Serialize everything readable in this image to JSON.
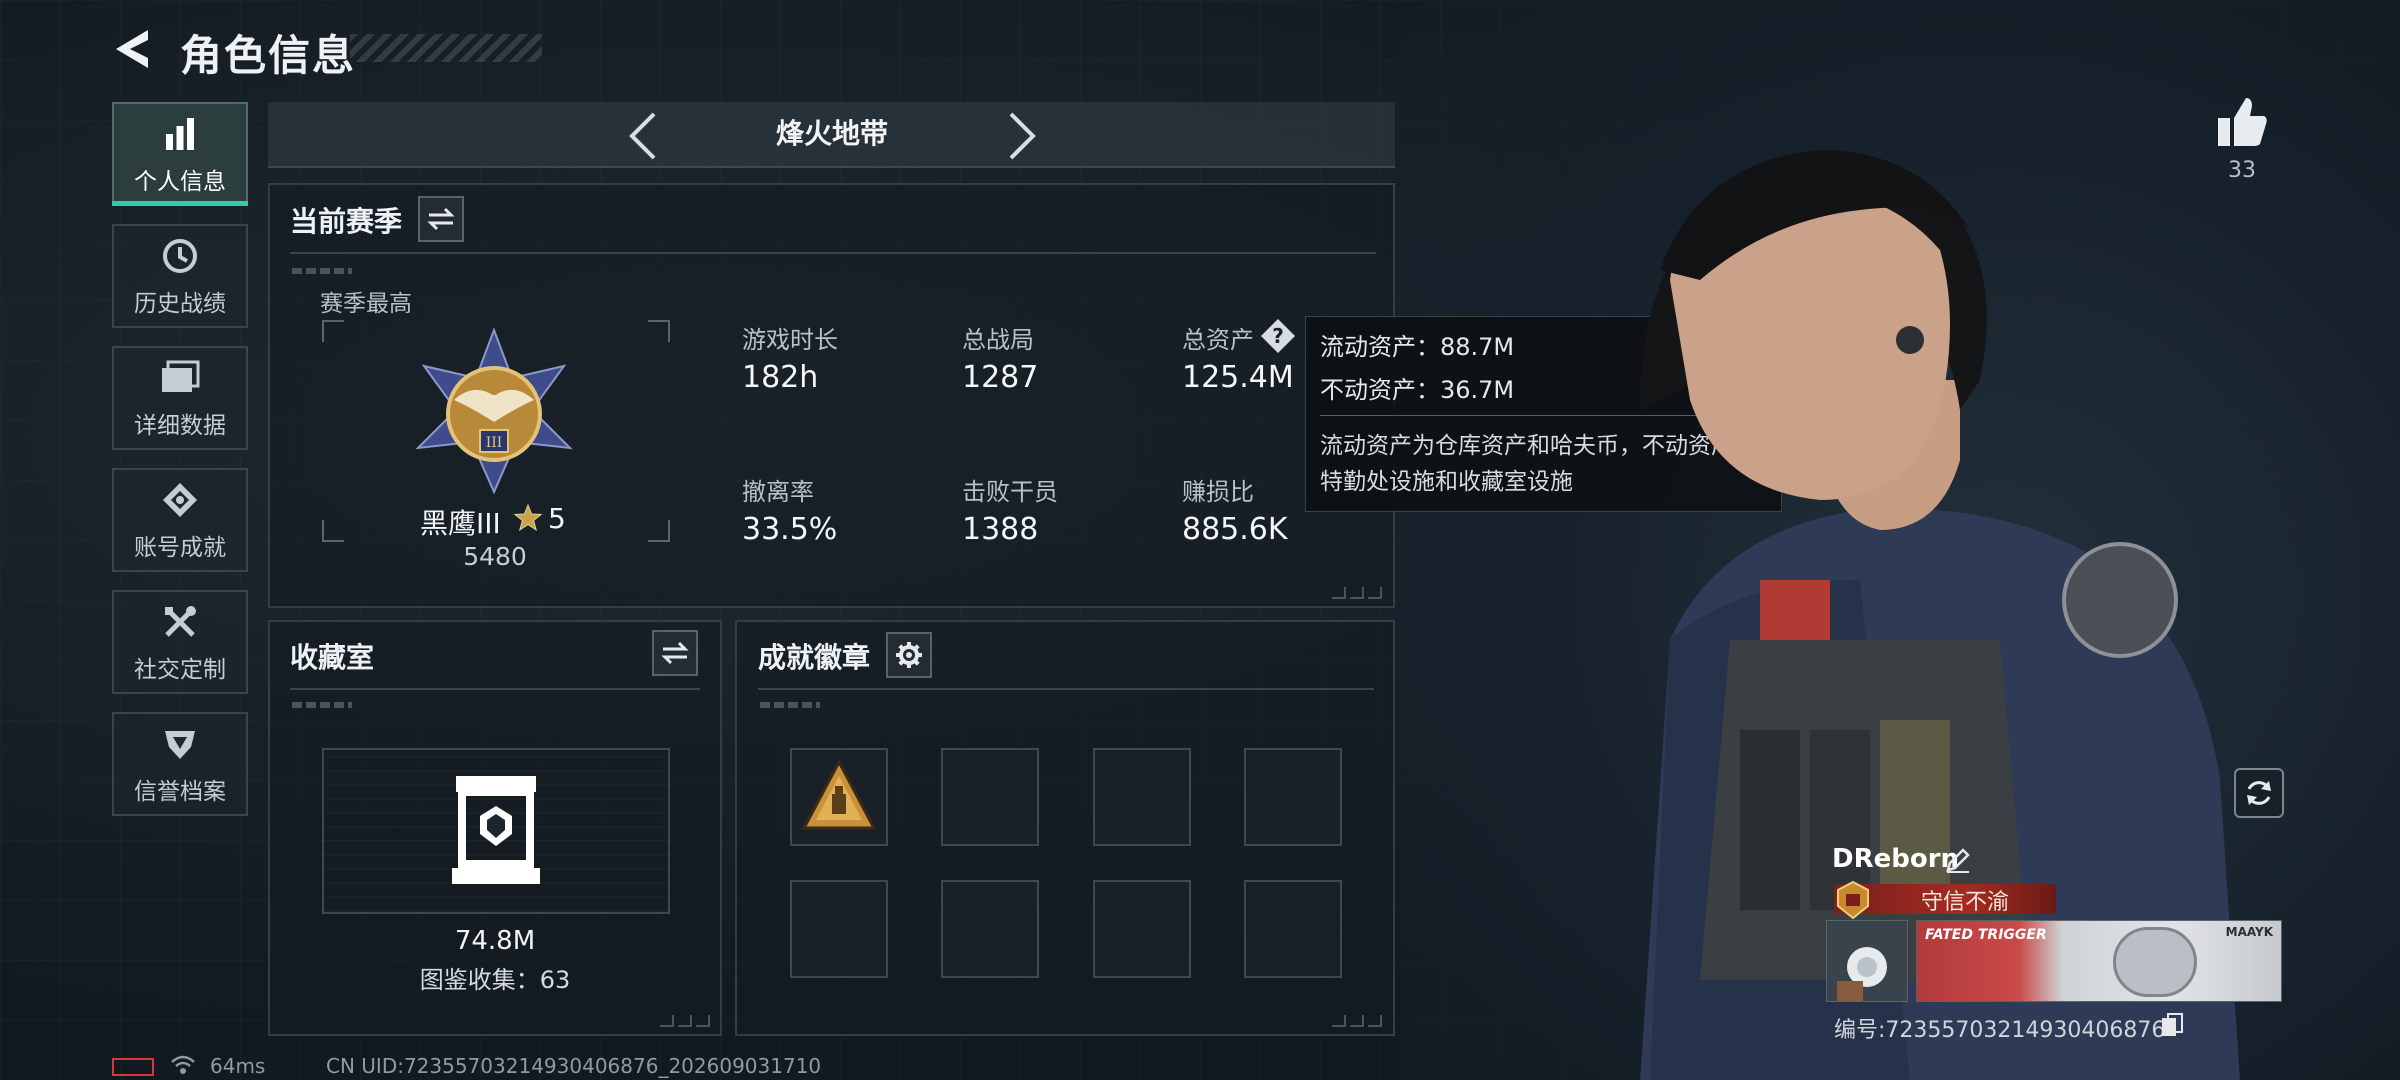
{
  "header": {
    "title": "角色信息"
  },
  "sidebar": {
    "items": [
      {
        "label": "个人信息",
        "active": true,
        "icon": "bar-chart-icon"
      },
      {
        "label": "历史战绩",
        "active": false,
        "icon": "clock-icon"
      },
      {
        "label": "详细数据",
        "active": false,
        "icon": "folder-icon"
      },
      {
        "label": "账号成就",
        "active": false,
        "icon": "achievement-icon"
      },
      {
        "label": "社交定制",
        "active": false,
        "icon": "tools-icon"
      },
      {
        "label": "信誉档案",
        "active": false,
        "icon": "shield-icon"
      }
    ]
  },
  "mode": {
    "label": "烽火地带"
  },
  "season": {
    "title": "当前赛季",
    "best_label": "赛季最高",
    "rank_name": "黑鹰III",
    "rank_stars": "5",
    "rank_score": "5480",
    "stats": [
      {
        "label": "游戏时长",
        "value": "182h"
      },
      {
        "label": "总战局",
        "value": "1287"
      },
      {
        "label": "总资产",
        "value": "125.4M"
      },
      {
        "label": "撤离率",
        "value": "33.5%"
      },
      {
        "label": "击败干员",
        "value": "1388"
      },
      {
        "label": "赚损比",
        "value": "885.6K"
      }
    ]
  },
  "tooltip": {
    "liquid": "流动资产：88.7M",
    "fixed": "不动资产：36.7M",
    "desc": "流动资产为仓库资产和哈夫币，不动资产为特勤处设施和收藏室设施"
  },
  "collection": {
    "title": "收藏室",
    "value": "74.8M",
    "catalog": "图鉴收集：63"
  },
  "badges": {
    "title": "成就徽章"
  },
  "player": {
    "likes": "33",
    "name": "DReborn",
    "title_badge": "守信不渝",
    "uid_label": "编号:72355703214930406876",
    "namecard_brand": "FATED TRIGGER",
    "namecard_tag": "MAAYK"
  },
  "status": {
    "ping": "64ms",
    "cn_uid": "CN UID:72355703214930406876_202609031710"
  },
  "colors": {
    "accent": "#39c9a6",
    "title_red": "#a52b22",
    "gold": "#c9a24a"
  }
}
